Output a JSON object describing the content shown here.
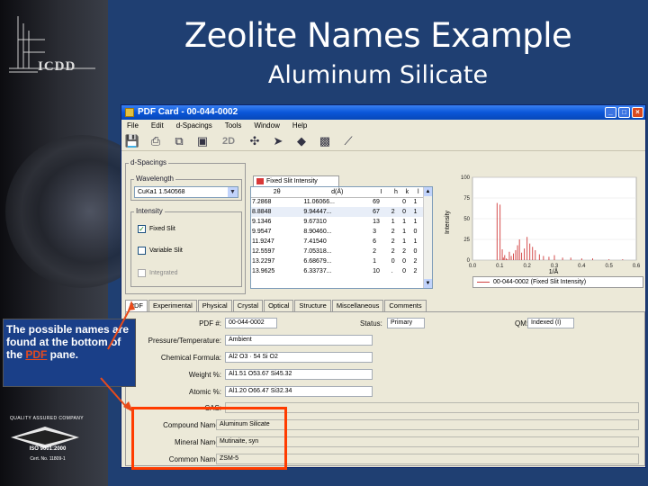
{
  "slide": {
    "title": "Zeolite Names Example",
    "subtitle": "Aluminum Silicate",
    "logo_text": "ICDD",
    "qa_text": "QUALITY ASSURED COMPANY",
    "iso_text": "ISO 9001:2000",
    "cert_text": "Cert. No. 11809-1",
    "callout_prefix": "The possible names are found at the bottom of the ",
    "callout_link": "PDF",
    "callout_suffix": " pane."
  },
  "window": {
    "title": "PDF Card - 00-044-0002",
    "menu": [
      "File",
      "Edit",
      "d-Spacings",
      "Tools",
      "Window",
      "Help"
    ],
    "toolbar_2d": "2D",
    "toolbar_icons": [
      "save-icon",
      "print-icon",
      "copy-icon",
      "copy-icon-2",
      "2d-icon",
      "structure-icon",
      "bird-icon",
      "crystal-icon",
      "cube-icon",
      "pattern-icon"
    ]
  },
  "dspacings": {
    "group": "d-Spacings",
    "wavelength_label": "Wavelength",
    "wavelength_value": "CuKa1 1.540568",
    "intensity_label": "Intensity",
    "fixed_slit": "Fixed Slit",
    "variable_slit": "Variable Slit",
    "integrated": "Integrated",
    "table_tab": "Fixed Slit Intensity",
    "columns": [
      "2θ",
      "d(Å)",
      "I",
      "h",
      "k",
      "l"
    ],
    "rows": [
      [
        "7.2868",
        "11.06066...",
        "69",
        "",
        "0",
        "1"
      ],
      [
        "8.8848",
        "9.94447...",
        "67",
        "2",
        "0",
        "1"
      ],
      [
        "9.1346",
        "9.67310",
        "13",
        "1",
        "1",
        "1"
      ],
      [
        "9.9547",
        "8.90460...",
        "3",
        "2",
        "1",
        "0"
      ],
      [
        "11.9247",
        "7.41540",
        "6",
        "2",
        "1",
        "1"
      ],
      [
        "12.5597",
        "7.05318...",
        "2",
        "2",
        "2",
        "0"
      ],
      [
        "13.2297",
        "6.68679...",
        "1",
        "0",
        "0",
        "2"
      ],
      [
        "13.9625",
        "6.33737...",
        "10",
        ".",
        "0",
        "2"
      ]
    ]
  },
  "chart_data": {
    "type": "bar",
    "title": "",
    "xlabel": "1/Å",
    "ylabel": "Intensity",
    "xlim": [
      0,
      0.6
    ],
    "ylim": [
      0,
      100
    ],
    "xticks": [
      "0.0",
      "0.1",
      "0.2",
      "0.3",
      "0.4",
      "0.5",
      "0.6"
    ],
    "yticks": [
      "0",
      "25",
      "50",
      "75",
      "100"
    ],
    "legend": "00-044-0002 (Fixed Slit Intensity)",
    "series": [
      {
        "x": [
          0.09,
          0.101,
          0.109,
          0.113,
          0.118,
          0.124,
          0.128,
          0.135,
          0.142,
          0.15,
          0.158,
          0.165,
          0.172,
          0.18,
          0.19,
          0.2,
          0.21,
          0.22,
          0.23,
          0.245,
          0.26,
          0.28,
          0.3,
          0.33,
          0.36,
          0.4,
          0.44,
          0.5,
          0.55
        ],
        "values": [
          69,
          67,
          13,
          3,
          6,
          2,
          1,
          10,
          5,
          8,
          12,
          18,
          25,
          9,
          14,
          28,
          20,
          16,
          12,
          7,
          5,
          4,
          6,
          3,
          3,
          2,
          2,
          1,
          1
        ]
      }
    ]
  },
  "tabs": [
    "PDF",
    "Experimental",
    "Physical",
    "Crystal",
    "Optical",
    "Structure",
    "Miscellaneous",
    "Comments"
  ],
  "pdf_fields": {
    "pdf_label": "PDF #:",
    "pdf_value": "00-044-0002",
    "status_label": "Status:",
    "status_value": "Primary",
    "qm_label": "QM:",
    "qm_value": "Indexed (I)",
    "pressure_label": "Pressure/Temperature:",
    "pressure_value": "Ambient",
    "formula_label": "Chemical Formula:",
    "formula_value": "Al2 O3 · 54 Si O2",
    "weight_label": "Weight %:",
    "weight_value": "Al1.51 O53.67 Si45.32",
    "atomic_label": "Atomic %:",
    "atomic_value": "Al1.20 O66.47 Si32.34",
    "cas_label": "CAS:",
    "cas_value": "",
    "compound_label": "Compound Name:",
    "compound_value": "Aluminum Silicate",
    "mineral_label": "Mineral Name:",
    "mineral_value": "Mutinaite, syn",
    "common_label": "Common Name:",
    "common_value": "ZSM-5"
  }
}
